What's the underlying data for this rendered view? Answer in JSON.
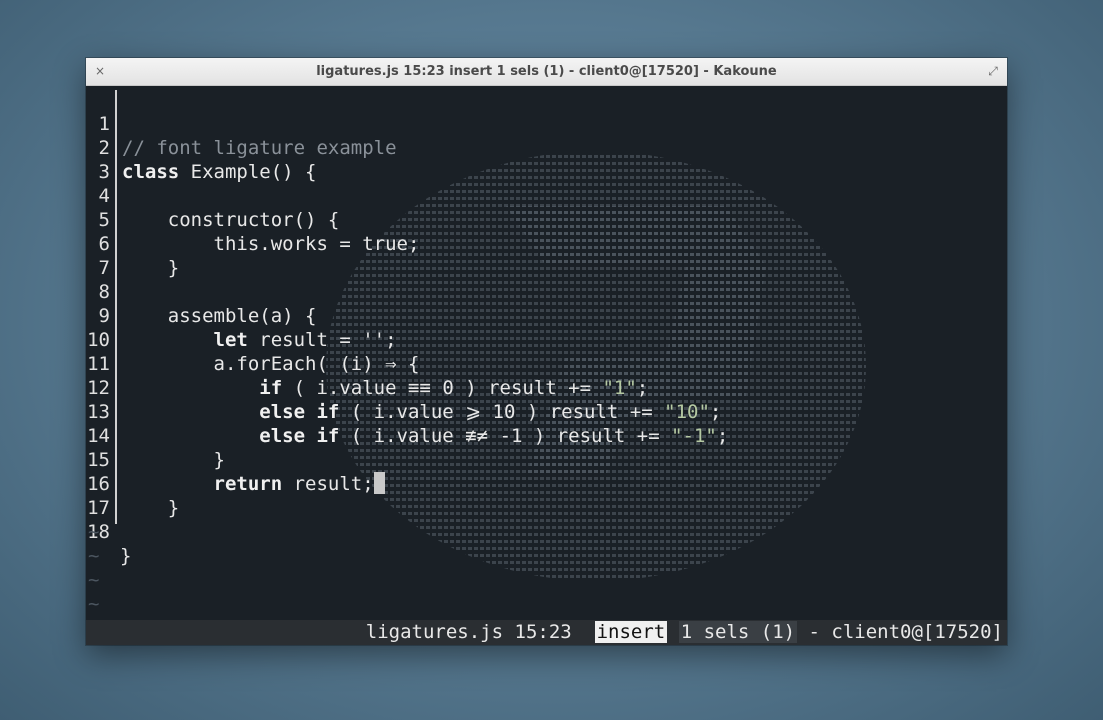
{
  "window": {
    "title": "ligatures.js 15:23 insert 1 sels (1) - client0@[17520] - Kakoune",
    "close_glyph": "×",
    "maximize_glyph": "⤢"
  },
  "editor": {
    "lines": [
      {
        "num": "1"
      },
      {
        "num": "2"
      },
      {
        "num": "3"
      },
      {
        "num": "4"
      },
      {
        "num": "5"
      },
      {
        "num": "6"
      },
      {
        "num": "7"
      },
      {
        "num": "8"
      },
      {
        "num": "9"
      },
      {
        "num": "10"
      },
      {
        "num": "11"
      },
      {
        "num": "12"
      },
      {
        "num": "13"
      },
      {
        "num": "14"
      },
      {
        "num": "15"
      },
      {
        "num": "16"
      },
      {
        "num": "17"
      },
      {
        "num": "18"
      }
    ],
    "code": {
      "l1_comment": "// font ligature example",
      "l2_kw": "class",
      "l2_rest": " Example() {",
      "l4": "    constructor() {",
      "l5": "        this.works = true;",
      "l6": "    }",
      "l8": "    assemble(a) {",
      "l9_indent": "        ",
      "l9_kw": "let",
      "l9_rest": " result = '';",
      "l10": "        a.forEach( (i) ⇒ {",
      "l11_indent": "            ",
      "l11_kw": "if",
      "l11_mid": " ( i.value ≡≡ 0 ) result += ",
      "l11_str": "\"1\"",
      "l11_end": ";",
      "l12_indent": "            ",
      "l12_kw": "else if",
      "l12_mid": " ( i.value ⩾ 10 ) result += ",
      "l12_str": "\"10\"",
      "l12_end": ";",
      "l13_indent": "            ",
      "l13_kw": "else if",
      "l13_mid": " ( i.value ≢≠ -1 ) result += ",
      "l13_str": "\"-1\"",
      "l13_end": ";",
      "l14": "        }",
      "l15_indent": "        ",
      "l15_kw": "return",
      "l15_rest": " result;",
      "l16": "    }",
      "l18": "}"
    },
    "empty_line_marker": "~"
  },
  "statusbar": {
    "file": "ligatures.js",
    "position": "15:23",
    "mode": "insert",
    "sels": "1 sels (1)",
    "client": "- client0@[17520]"
  }
}
